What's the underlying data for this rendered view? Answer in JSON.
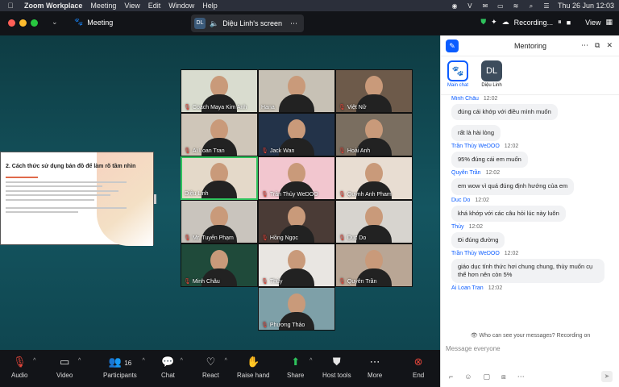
{
  "menubar": {
    "app": "Zoom Workplace",
    "items": [
      "Meeting",
      "View",
      "Edit",
      "Window",
      "Help"
    ],
    "datetime": "Thu 26 Jun  12:03"
  },
  "window": {
    "title": "Meeting",
    "share_tab": {
      "initials": "DL",
      "label": "Diệu Linh's screen"
    },
    "recording": "Recording...",
    "view": "View"
  },
  "slide": {
    "title": "2. Cách thức sử dụng bản đồ để làm rõ tầm nhìn"
  },
  "participants": [
    {
      "name": "Coach Maya Kim Anh",
      "muted": true,
      "bg": "#d9dccf"
    },
    {
      "name": "Hana",
      "muted": false,
      "bg": "#c7c1b5"
    },
    {
      "name": "Việt Nữ",
      "muted": true,
      "bg": "#6d5a4a"
    },
    {
      "name": "Ai Loan Tran",
      "muted": true,
      "bg": "#cfc6b9"
    },
    {
      "name": "Jack Wan",
      "muted": true,
      "bg": "#233349"
    },
    {
      "name": "Hoài Anh",
      "muted": true,
      "bg": "#7a6e60"
    },
    {
      "name": "Diệu Linh",
      "muted": false,
      "bg": "#e4d9c9",
      "active": true
    },
    {
      "name": "Trần Thủy WeDOO",
      "muted": true,
      "bg": "#f2c6cf"
    },
    {
      "name": "Quynh Anh Pham",
      "muted": true,
      "bg": "#e8ddd2"
    },
    {
      "name": "Mr. Tuyến Phạm",
      "muted": true,
      "bg": "#c9c4bd"
    },
    {
      "name": "Hồng Ngọc",
      "muted": true,
      "bg": "#4a3b36"
    },
    {
      "name": "Duc Do",
      "muted": true,
      "bg": "#d7d4cf"
    },
    {
      "name": "Minh Châu",
      "muted": true,
      "bg": "#1f4a3a"
    },
    {
      "name": "Thùy",
      "muted": true,
      "bg": "#e9e6e2"
    },
    {
      "name": "Quyên Trần",
      "muted": true,
      "bg": "#b9a695"
    },
    {
      "name": "Phương Thảo",
      "muted": true,
      "bg": "#7ea0a8"
    }
  ],
  "toolbar": {
    "audio": "Audio",
    "video": "Video",
    "participants": "Participants",
    "participants_count": "16",
    "chat": "Chat",
    "react": "React",
    "raise_hand": "Raise hand",
    "share": "Share",
    "host_tools": "Host tools",
    "more": "More",
    "end": "End"
  },
  "panel": {
    "title": "Mentoring",
    "channels": [
      {
        "label": "Main chat"
      },
      {
        "label": "Diệu Linh",
        "initials": "DL"
      }
    ],
    "messages": [
      {
        "sender": "Minh Châu",
        "time": "12:02",
        "bubbles": [
          "đúng cái khớp với điều mình muốn",
          "rất là hài lòng"
        ]
      },
      {
        "sender": "Trần Thủy WeDOO",
        "time": "12:02",
        "bubbles": [
          "95% đúng cái em muốn"
        ]
      },
      {
        "sender": "Quyên Trần",
        "time": "12:02",
        "bubbles": [
          "em wow vì quá đúng định hướng của em"
        ]
      },
      {
        "sender": "Duc Do",
        "time": "12:02",
        "bubbles": [
          "khá khớp với các câu hỏi lúc này luôn"
        ]
      },
      {
        "sender": "Thùy",
        "time": "12:02",
        "bubbles": [
          "Đi đúng đường"
        ]
      },
      {
        "sender": "Trần Thủy WeDOO",
        "time": "12:02",
        "bubbles": [
          "giáo dục tính thức hơi chung chung, thùy muốn cụ thể hơn nên còn 5%"
        ]
      },
      {
        "sender": "Ai Loan Tran",
        "time": "12:02",
        "bubbles": []
      }
    ],
    "notice": "Who can see your messages? Recording on",
    "input_placeholder": "Message everyone"
  }
}
